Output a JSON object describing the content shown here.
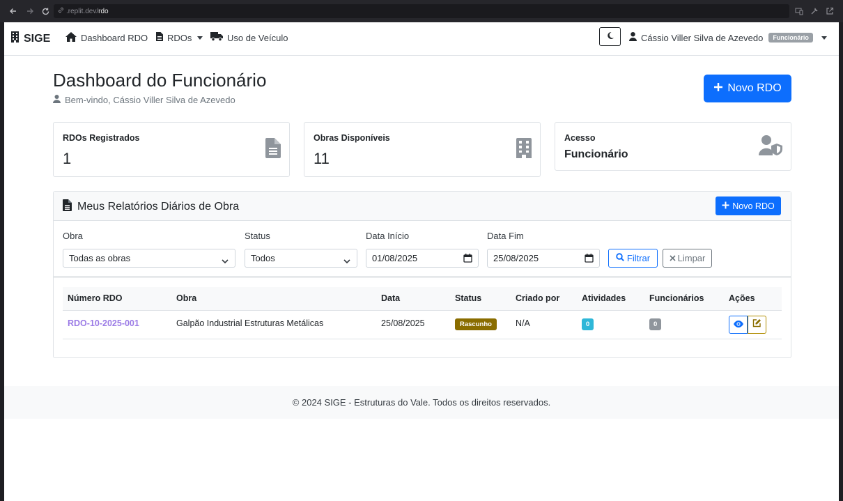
{
  "browser": {
    "url_host_prefix": ".replit.dev/",
    "url_path": "rdo"
  },
  "navbar": {
    "brand": "SIGE",
    "items": [
      {
        "label": "Dashboard RDO",
        "icon": "home-icon"
      },
      {
        "label": "RDOs",
        "icon": "file-icon"
      },
      {
        "label": "Uso de Veículo",
        "icon": "truck-icon"
      }
    ],
    "user_name": "Cássio Viller Silva de Azevedo",
    "user_role_badge": "Funcionário"
  },
  "header": {
    "title": "Dashboard do Funcionário",
    "welcome": "Bem-vindo, Cássio Viller Silva de Azevedo",
    "new_rdo_label": "Novo RDO"
  },
  "stats": [
    {
      "label": "RDOs Registrados",
      "value": "1",
      "icon": "file-alt-icon"
    },
    {
      "label": "Obras Disponíveis",
      "value": "11",
      "icon": "building-icon"
    },
    {
      "label": "Acesso",
      "value": "Funcionário",
      "icon": "user-shield-icon"
    }
  ],
  "reports": {
    "title": "Meus Relatórios Diários de Obra",
    "new_rdo_label": "Novo RDO",
    "filters": {
      "obra_label": "Obra",
      "obra_value": "Todas as obras",
      "status_label": "Status",
      "status_value": "Todos",
      "data_inicio_label": "Data Início",
      "data_inicio_value": "01/08/2025",
      "data_fim_label": "Data Fim",
      "data_fim_value": "25/08/2025",
      "filter_label": "Filtrar",
      "clear_label": "Limpar"
    },
    "columns": [
      "Número RDO",
      "Obra",
      "Data",
      "Status",
      "Criado por",
      "Atividades",
      "Funcionários",
      "Ações"
    ],
    "rows": [
      {
        "numero": "RDO-10-2025-001",
        "obra": "Galpão Industrial Estruturas Metálicas",
        "data": "25/08/2025",
        "status": "Rascunho",
        "criado_por": "N/A",
        "atividades": "0",
        "funcionarios": "0"
      }
    ]
  },
  "footer": {
    "text": "© 2024 SIGE - Estruturas do Vale. Todos os direitos reservados."
  },
  "colors": {
    "primary": "#0d6efd",
    "draft_badge": "#8a6d00",
    "info_badge": "#2eb7d8",
    "secondary_badge": "#8f959c",
    "link": "#9b7be6"
  }
}
